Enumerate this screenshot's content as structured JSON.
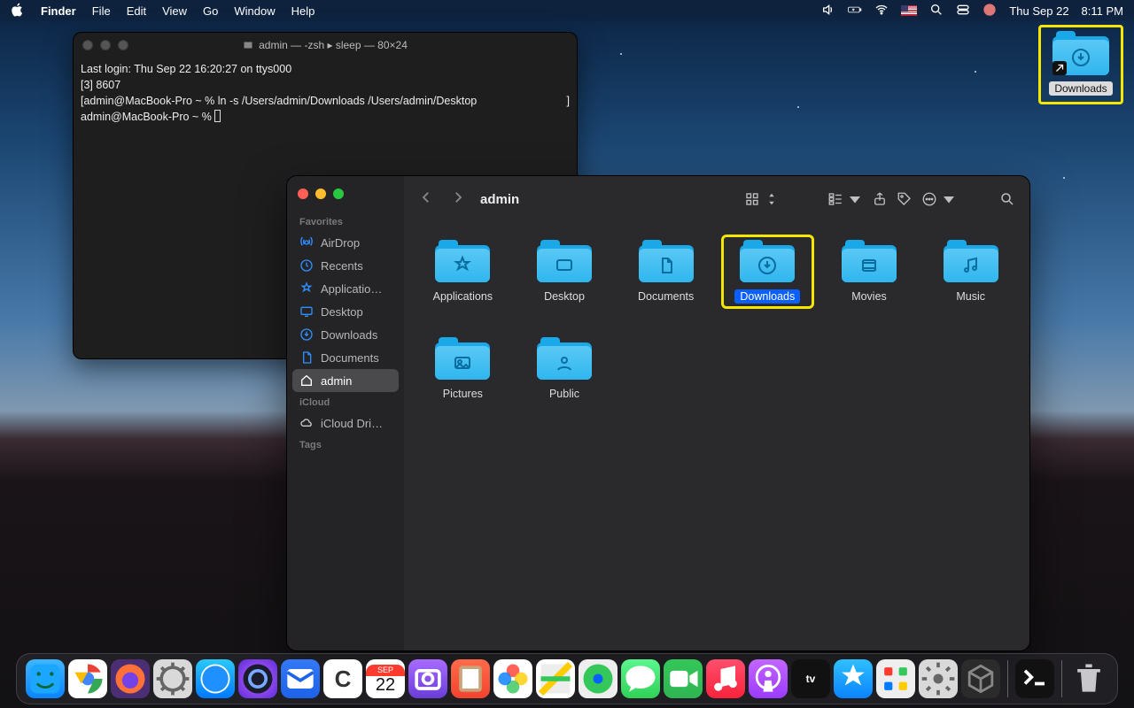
{
  "menubar": {
    "app": "Finder",
    "items": [
      "File",
      "Edit",
      "View",
      "Go",
      "Window",
      "Help"
    ],
    "date": "Thu Sep 22",
    "time": "8:11 PM"
  },
  "desktop": {
    "downloads_label": "Downloads"
  },
  "terminal": {
    "title": "admin — -zsh ▸ sleep — 80×24",
    "line1": "Last login: Thu Sep 22 16:20:27 on ttys000",
    "line2": "[3] 8607",
    "line3": "[admin@MacBook-Pro ~ % ln -s /Users/admin/Downloads /Users/admin/Desktop",
    "line3_end": "]",
    "line4": "admin@MacBook-Pro ~ % "
  },
  "finder": {
    "title": "admin",
    "sidebar": {
      "favorites": "Favorites",
      "icloud": "iCloud",
      "tags": "Tags",
      "items": {
        "airdrop": "AirDrop",
        "recents": "Recents",
        "applications": "Applicatio…",
        "desktop": "Desktop",
        "downloads": "Downloads",
        "documents": "Documents",
        "admin": "admin",
        "iclouddrive": "iCloud Dri…"
      }
    },
    "folders": {
      "applications": "Applications",
      "desktop": "Desktop",
      "documents": "Documents",
      "downloads": "Downloads",
      "movies": "Movies",
      "music": "Music",
      "pictures": "Pictures",
      "public": "Public"
    }
  },
  "dock": {
    "cal_month": "SEP",
    "cal_day": "22"
  }
}
